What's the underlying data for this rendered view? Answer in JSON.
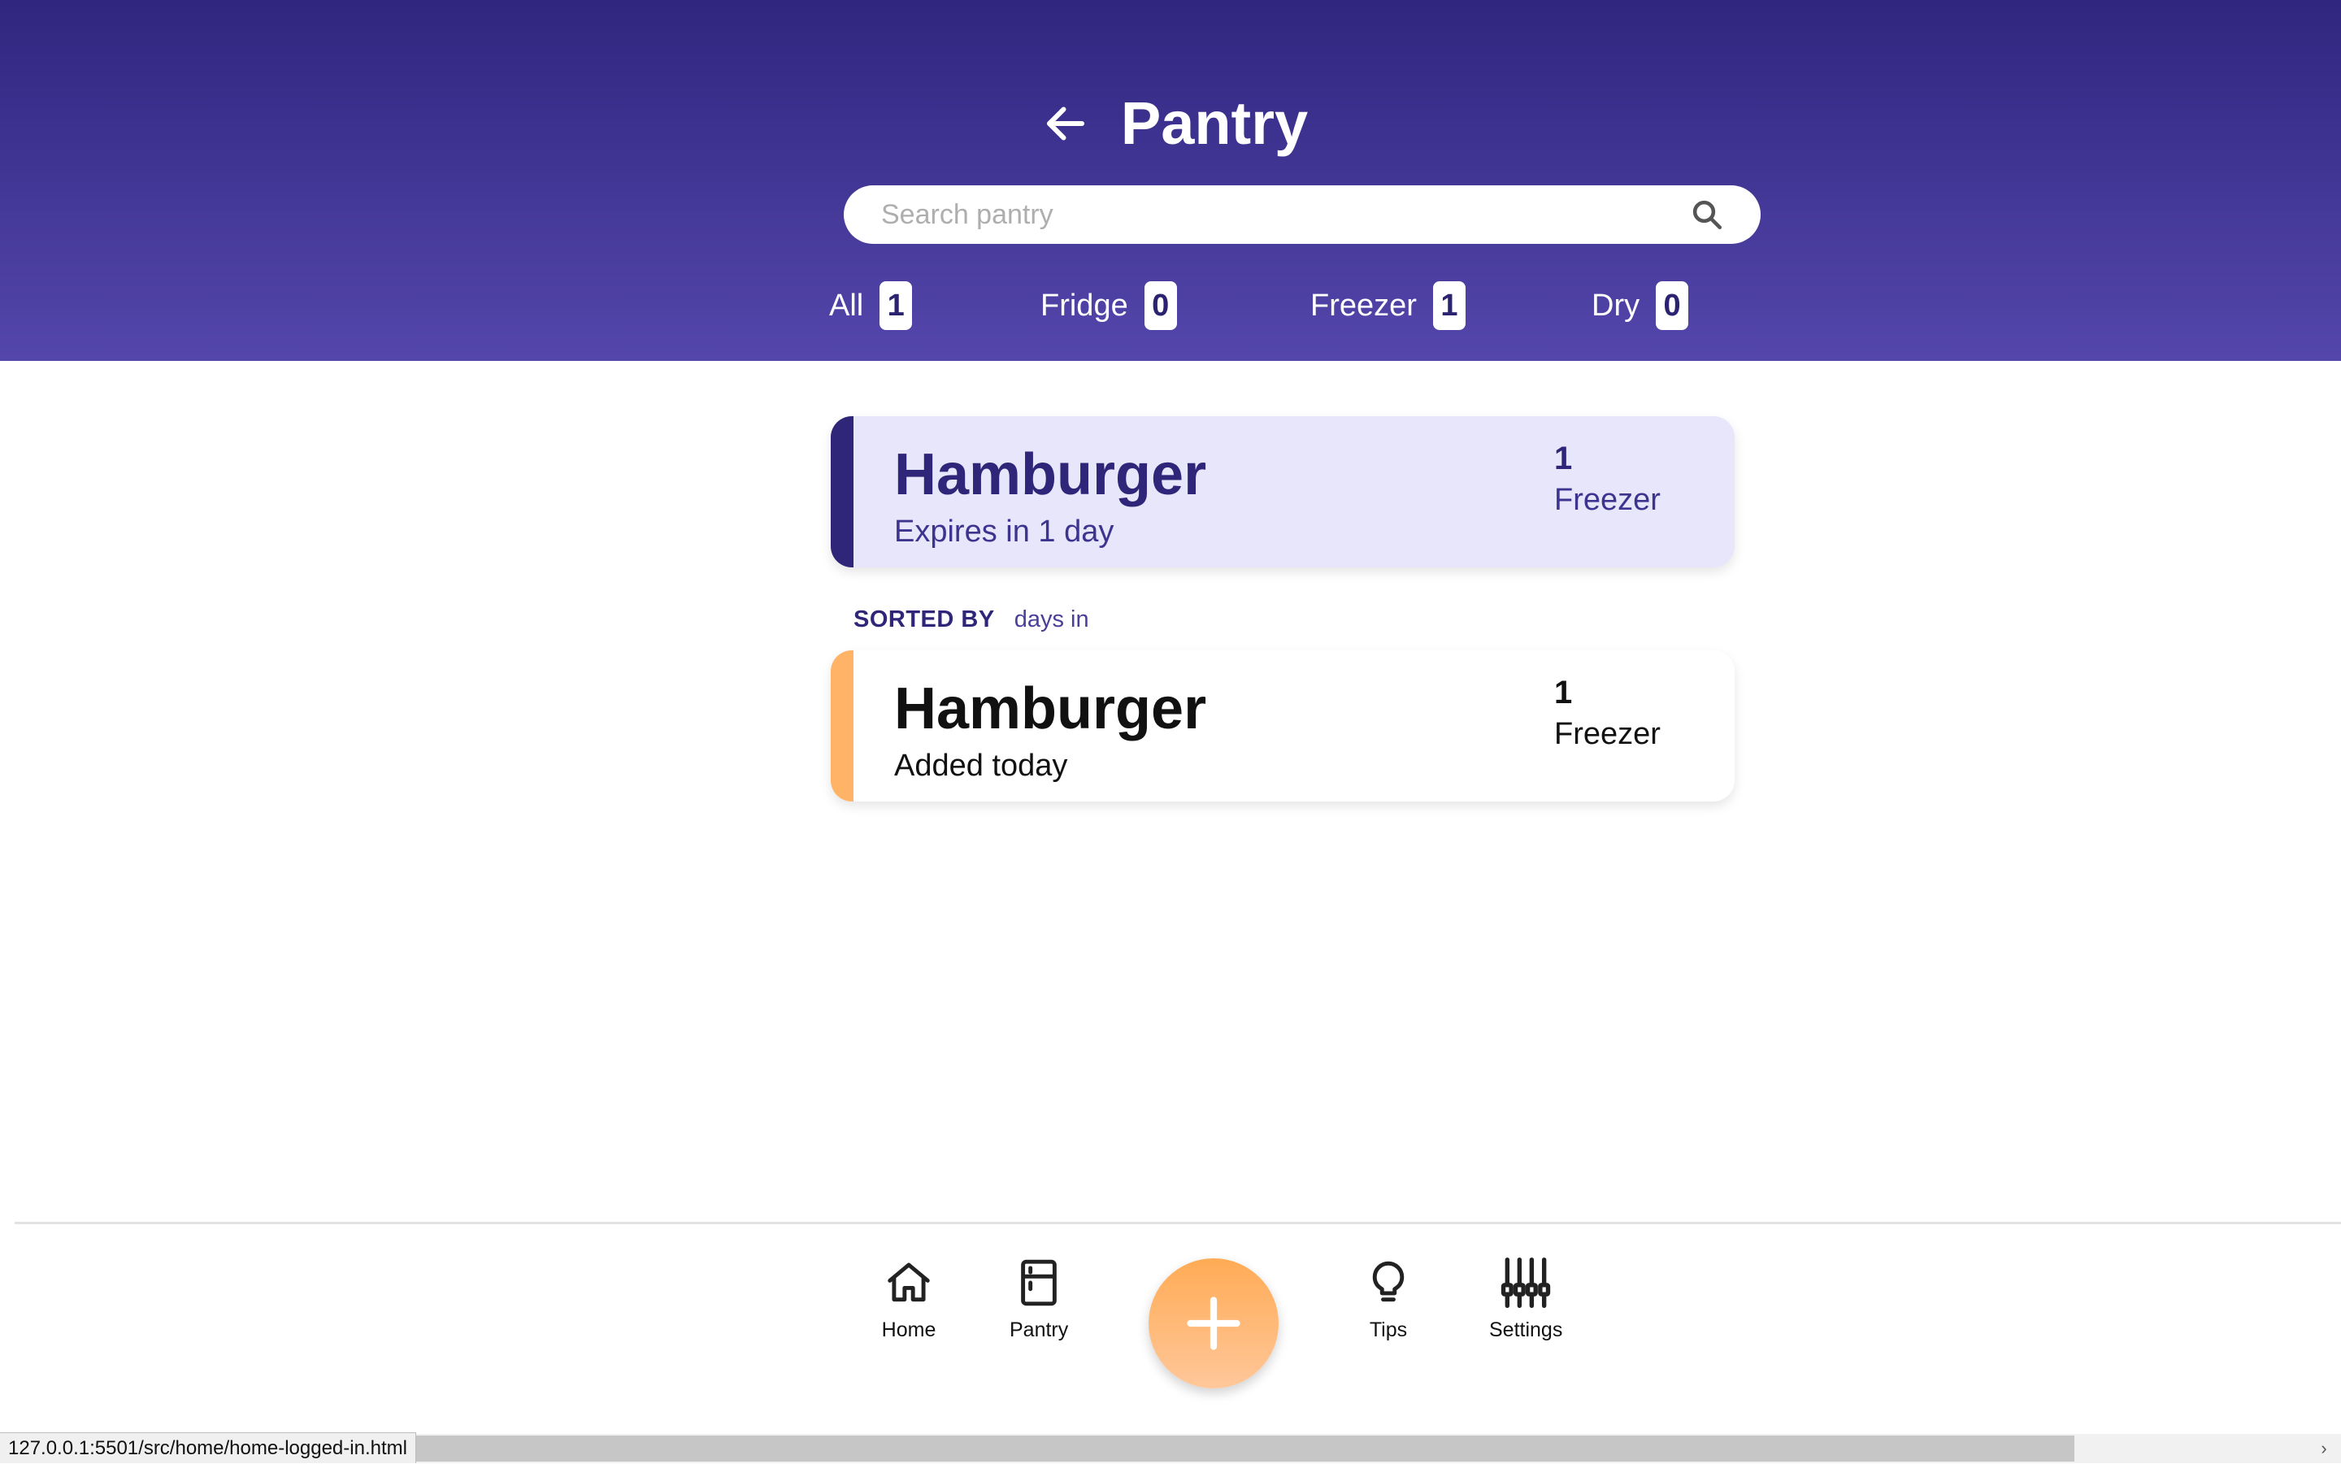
{
  "header": {
    "title": "Pantry",
    "back_icon": "arrow-left-icon"
  },
  "search": {
    "placeholder": "Search pantry",
    "value": "",
    "icon": "search-icon"
  },
  "filters": [
    {
      "label": "All",
      "count": "1"
    },
    {
      "label": "Fridge",
      "count": "0"
    },
    {
      "label": "Freezer",
      "count": "1"
    },
    {
      "label": "Dry",
      "count": "0"
    }
  ],
  "expiring_card": {
    "name": "Hamburger",
    "status": "Expires in 1 day",
    "quantity": "1",
    "location": "Freezer"
  },
  "sort": {
    "label": "SORTED BY",
    "value": "days in"
  },
  "items": [
    {
      "name": "Hamburger",
      "status": "Added today",
      "quantity": "1",
      "location": "Freezer"
    }
  ],
  "nav": {
    "home": "Home",
    "pantry": "Pantry",
    "tips": "Tips",
    "settings": "Settings",
    "add_icon": "plus-icon"
  },
  "browser": {
    "status_url": "127.0.0.1:5501/src/home/home-logged-in.html"
  },
  "colors": {
    "header_top": "#30267f",
    "header_bottom": "#5446ab",
    "primary_accent": "#2f2679",
    "secondary_accent": "#ffb366",
    "expiring_card_bg": "#e8e6fb"
  }
}
